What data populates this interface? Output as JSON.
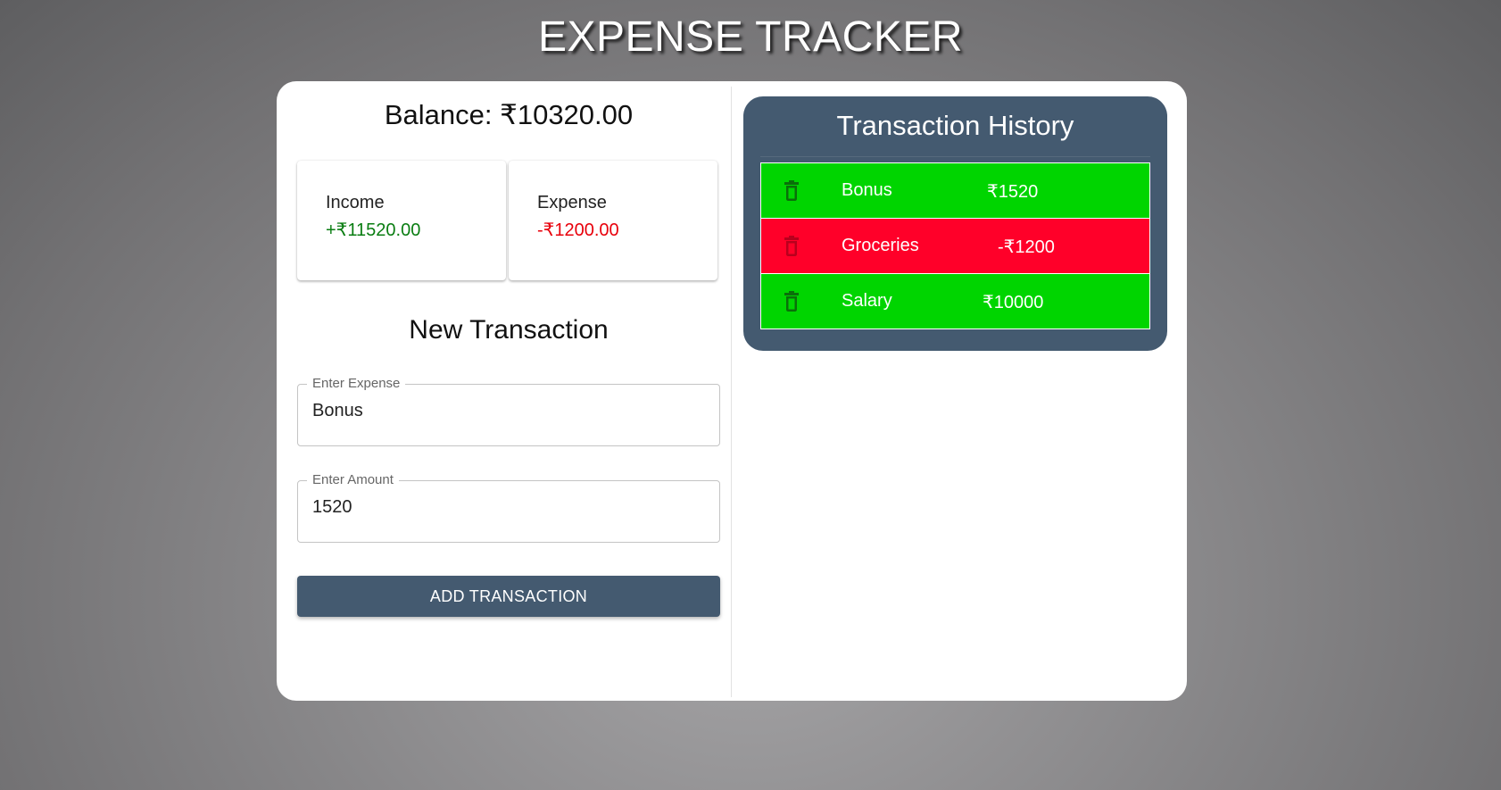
{
  "app": {
    "title": "EXPENSE TRACKER"
  },
  "balance": {
    "label": "Balance: ₹10320.00"
  },
  "summary": {
    "income": {
      "label": "Income",
      "value": "+₹11520.00",
      "color": "#0a7d12"
    },
    "expense": {
      "label": "Expense",
      "value": "-₹1200.00",
      "color": "#e8000b"
    }
  },
  "form": {
    "title": "New Transaction",
    "expense_label": "Enter Expense",
    "expense_value": "Bonus",
    "amount_label": "Enter Amount",
    "amount_value": "1520",
    "submit_label": "ADD TRANSACTION"
  },
  "history": {
    "title": "Transaction History",
    "transactions": [
      {
        "name": "Bonus",
        "amount": "₹1520",
        "type": "income",
        "icon": "trash-icon"
      },
      {
        "name": "Groceries",
        "amount": "-₹1200",
        "type": "expense",
        "icon": "trash-icon"
      },
      {
        "name": "Salary",
        "amount": "₹10000",
        "type": "income",
        "icon": "trash-icon"
      }
    ]
  },
  "colors": {
    "accent": "#445a70",
    "income_row": "#00d500",
    "expense_row": "#ff0029"
  }
}
